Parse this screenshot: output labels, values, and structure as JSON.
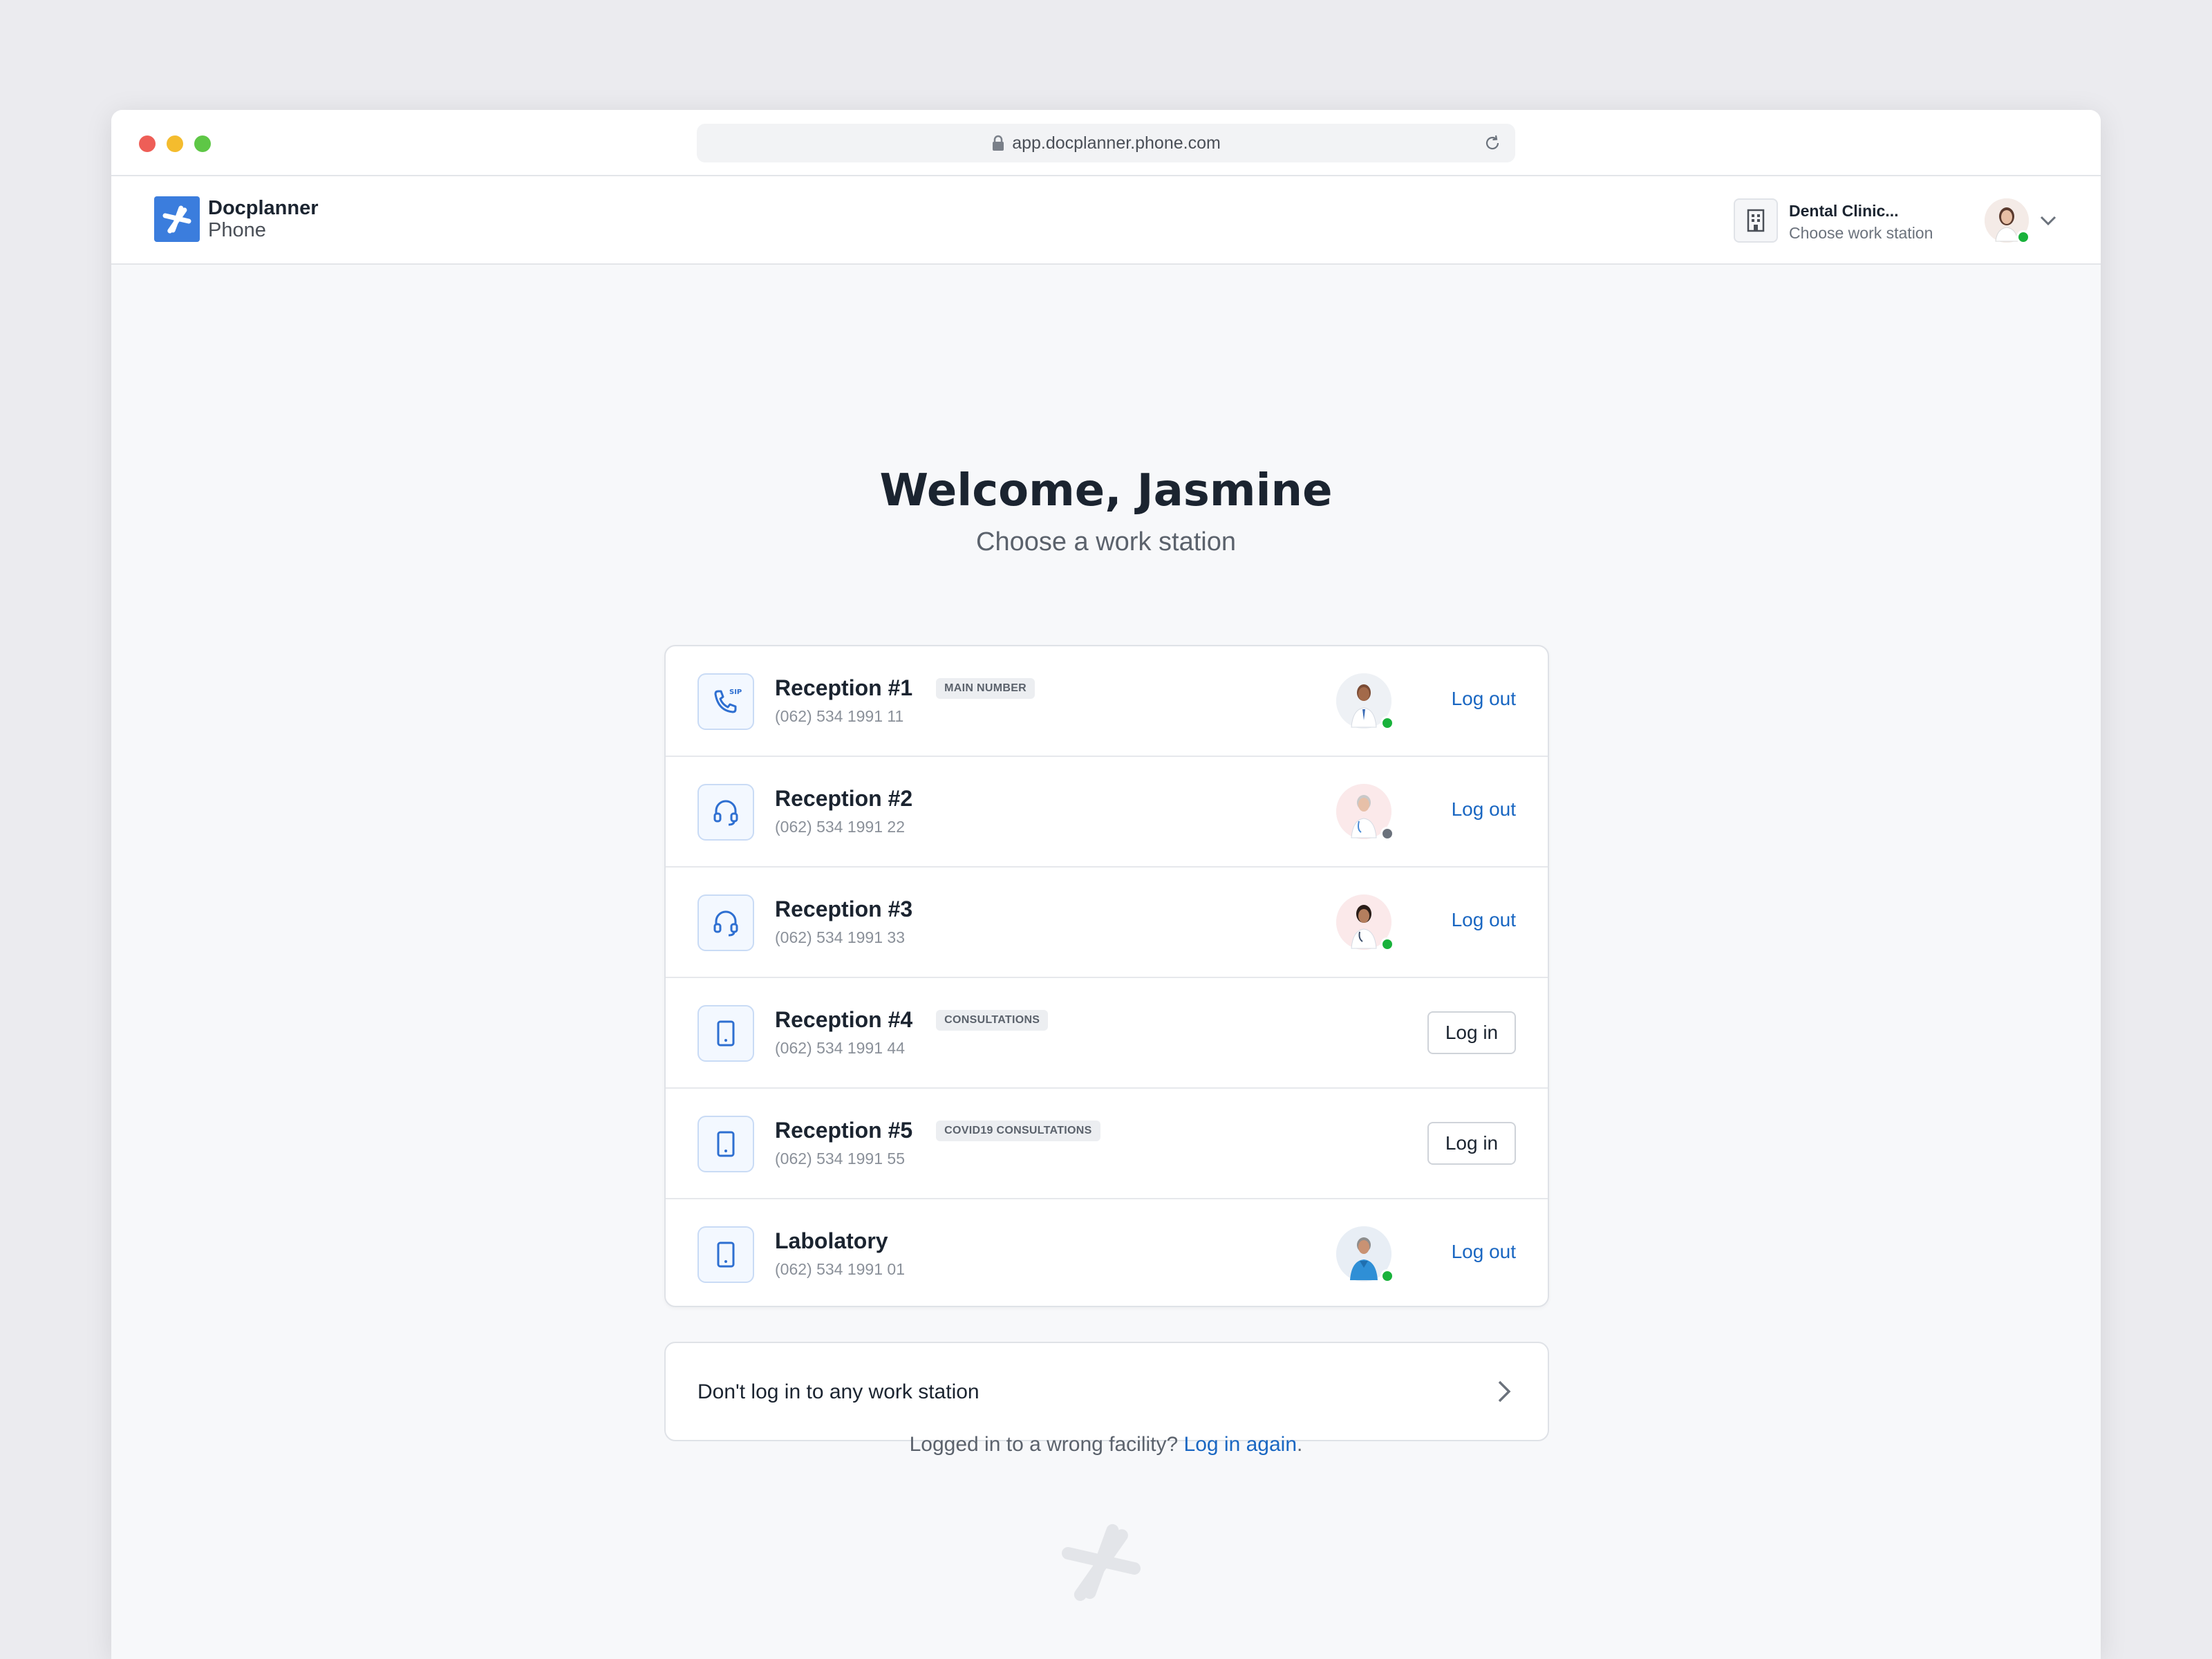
{
  "browser": {
    "url": "app.docplanner.phone.com"
  },
  "header": {
    "brand_line1": "Docplanner",
    "brand_line2": "Phone",
    "facility_name": "Dental Clinic...",
    "facility_sub": "Choose work station"
  },
  "main": {
    "welcome": "Welcome, Jasmine",
    "subtitle": "Choose a work station",
    "stations": [
      {
        "name": "Reception #1",
        "badge": "MAIN NUMBER",
        "phone": "(062) 534 1991 11",
        "icon": "sip-phone-icon",
        "action": "Log out",
        "status": "online"
      },
      {
        "name": "Reception #2",
        "badge": "",
        "phone": "(062) 534 1991 22",
        "icon": "headset-icon",
        "action": "Log out",
        "status": "away"
      },
      {
        "name": "Reception #3",
        "badge": "",
        "phone": "(062) 534 1991 33",
        "icon": "headset-icon",
        "action": "Log out",
        "status": "online"
      },
      {
        "name": "Reception #4",
        "badge": "CONSULTATIONS",
        "phone": "(062) 534 1991 44",
        "icon": "tablet-icon",
        "action": "Log in",
        "status": ""
      },
      {
        "name": "Reception #5",
        "badge": "COVID19 CONSULTATIONS",
        "phone": "(062) 534 1991 55",
        "icon": "tablet-icon",
        "action": "Log in",
        "status": ""
      },
      {
        "name": "Labolatory",
        "badge": "",
        "phone": "(062) 534 1991 01",
        "icon": "tablet-icon",
        "action": "Log out",
        "status": "online"
      }
    ],
    "skip_label": "Don't log in to any work station",
    "wrong_text": "Logged in to a wrong facility?",
    "wrong_link": "Log in again",
    "wrong_end": "."
  },
  "colors": {
    "accent": "#3b7ddd",
    "link": "#1a67c2",
    "online": "#19b23b",
    "away": "#6b727c"
  }
}
